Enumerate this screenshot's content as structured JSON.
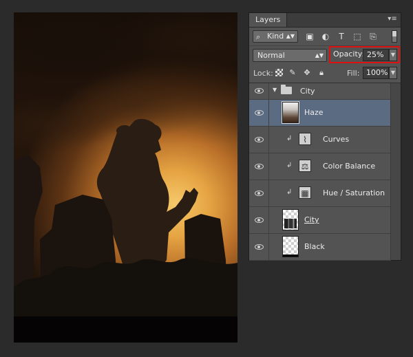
{
  "panel": {
    "tab_label": "Layers",
    "menu_icon": "panel-menu-icon",
    "filter": {
      "kind_label": "Kind",
      "icons": [
        "pixel-filter-icon",
        "adjustment-filter-icon",
        "type-filter-icon",
        "shape-filter-icon",
        "smart-object-filter-icon"
      ]
    },
    "blend_mode": "Normal",
    "opacity_label": "Opacity:",
    "opacity_value": "25%",
    "lock_label": "Lock:",
    "fill_label": "Fill:",
    "fill_value": "100%"
  },
  "layers": [
    {
      "name": "City",
      "type": "group",
      "visible": true
    },
    {
      "name": "Haze",
      "type": "pixel",
      "selected": true,
      "visible": true
    },
    {
      "name": "Curves",
      "type": "adjustment",
      "icon": "curves-icon",
      "clipped": true,
      "visible": true
    },
    {
      "name": "Color Balance",
      "type": "adjustment",
      "icon": "color-balance-icon",
      "clipped": true,
      "visible": true
    },
    {
      "name": "Hue / Saturation",
      "type": "adjustment",
      "icon": "hue-saturation-icon",
      "clipped": true,
      "visible": true
    },
    {
      "name": "City",
      "type": "smart-object",
      "visible": true
    },
    {
      "name": "Black",
      "type": "pixel",
      "visible": true
    }
  ],
  "colors": {
    "panel_bg": "#535353",
    "selected_row": "#5b6b82",
    "highlight_box": "#e01010"
  }
}
